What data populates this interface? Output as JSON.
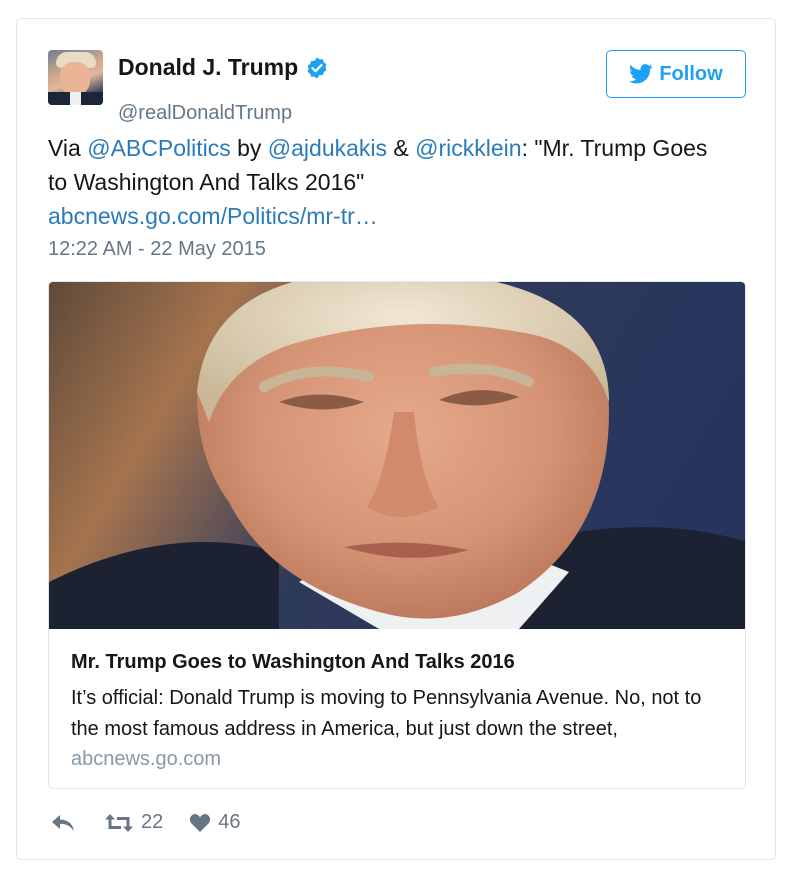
{
  "author": {
    "name": "Donald J. Trump",
    "handle": "@realDonaldTrump",
    "verified": true
  },
  "follow_button": {
    "label": "Follow",
    "icon": "twitter-bird-icon"
  },
  "tweet": {
    "text_parts": [
      "Via ",
      "@ABCPolitics",
      " by ",
      "@ajdukakis",
      " & ",
      "@rickklein",
      ": \"Mr. Trump Goes to Washington And Talks 2016\""
    ],
    "link": "abcnews.go.com/Politics/mr-tr…",
    "timestamp": "12:22 AM - 22 May 2015"
  },
  "card": {
    "title": "Mr. Trump Goes to Washington And Talks 2016",
    "description": "It’s official: Donald Trump is moving to Pennsylvania Avenue. No, not to the most famous address in America, but just down the street,",
    "domain": "abcnews.go.com"
  },
  "actions": {
    "reply_icon": "reply-icon",
    "retweet_icon": "retweet-icon",
    "retweet_count": "22",
    "like_icon": "heart-icon",
    "like_count": "46"
  },
  "colors": {
    "link": "#2b7bb9",
    "brand": "#1da1f2",
    "muted": "#657786",
    "border": "#e1e8ed"
  }
}
